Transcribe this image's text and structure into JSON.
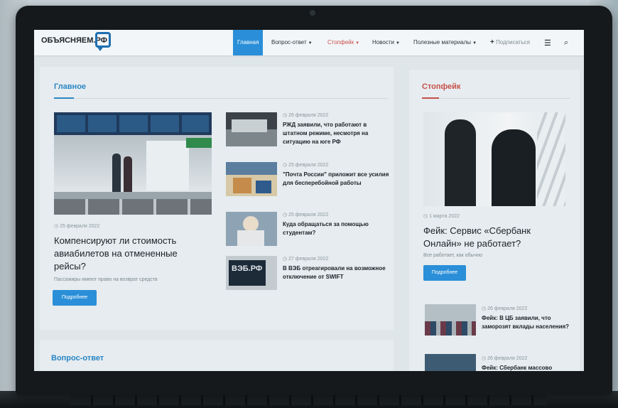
{
  "site": {
    "logo": "ОБЪЯСНЯЕМ.РФ"
  },
  "nav": {
    "items": [
      {
        "label": "Главная",
        "active": true,
        "caret": false
      },
      {
        "label": "Вопрос-ответ",
        "caret": true
      },
      {
        "label": "Стопфейк",
        "caret": true,
        "color": "#c8504a"
      },
      {
        "label": "Новости",
        "caret": true
      },
      {
        "label": "Полезные материалы",
        "caret": true
      }
    ],
    "subscribe": "Подписаться",
    "menu_icon": "hamburger-icon",
    "search_icon": "search-icon"
  },
  "main": {
    "section_title": "Главное",
    "feature": {
      "date": "25 февраля 2022",
      "title": "Компенсируют ли стоимость авиабилетов на отмененные рейсы?",
      "summary": "Пассажиры имеют право на возврат средств",
      "button": "Подробнее"
    },
    "items": [
      {
        "date": "26 февраля 2022",
        "title": "РЖД заявили, что работают в штатном режиме, несмотря на ситуацию на юге РФ"
      },
      {
        "date": "25 февраля 2022",
        "title": "\"Почта России\" приложит все усилия для бесперебойной работы"
      },
      {
        "date": "25 февраля 2022",
        "title": "Куда обращаться за помощью студентам?"
      },
      {
        "date": "27 февраля 2022",
        "title": "В ВЭБ отреагировали на возможное отключение от SWIFT"
      }
    ],
    "veb_logo": "ВЭБ.РФ"
  },
  "sidebar": {
    "section_title": "Стопфейк",
    "feature": {
      "date": "1 марта 2022",
      "title": "Фейк: Сервис «Сбербанк Онлайн» не работает?",
      "summary": "Все работает, как обычно",
      "button": "Подробнее"
    },
    "items": [
      {
        "date": "26 февраля 2022",
        "title": "Фейк: В ЦБ заявили, что заморозят вклады населения?"
      },
      {
        "date": "26 февраля 2022",
        "title": "Фейк: Сбербанк массово"
      }
    ]
  },
  "qa": {
    "section_title": "Вопрос-ответ"
  }
}
